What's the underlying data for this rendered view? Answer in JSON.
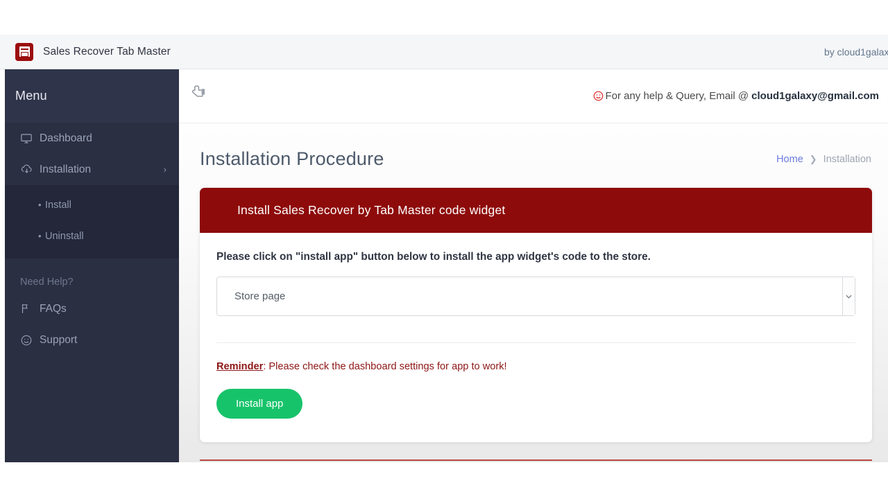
{
  "appbar": {
    "title": "Sales Recover Tab Master",
    "icon": "app-window-icon",
    "author": "by cloud1galax"
  },
  "sidebar": {
    "menu_label": "Menu",
    "items": [
      {
        "label": "Dashboard",
        "icon": "monitor-icon"
      },
      {
        "label": "Installation",
        "icon": "cloud-download-icon",
        "chevron": "›"
      }
    ],
    "sub_items": [
      {
        "label": "Install",
        "bullet": "•"
      },
      {
        "label": "Uninstall",
        "bullet": "•"
      }
    ],
    "help_label": "Need Help?",
    "help_items": [
      {
        "label": "FAQs",
        "icon": "flag-icon"
      },
      {
        "label": "Support",
        "icon": "smiley-icon"
      }
    ]
  },
  "topbar": {
    "cursor_icon": "hand-pointer-cursor",
    "smiley_icon": "smiley-face-icon",
    "help_prefix": "For any help & Query, Email @ ",
    "email": "cloud1galaxy@gmail.com"
  },
  "page": {
    "title": "Installation Procedure",
    "breadcrumb": {
      "home": "Home",
      "separator": "❯",
      "current": "Installation"
    }
  },
  "card": {
    "header": "Install Sales Recover by Tab Master code widget",
    "instruction": "Please click on \"install app\" button below to install the app widget's code to the store.",
    "select": {
      "value": "Store page",
      "arrow_icon": "chevron-down-icon"
    },
    "reminder_label": "Reminder",
    "reminder_text": ": Please check the dashboard settings for app to work!",
    "install_button": "Install app"
  },
  "colors": {
    "sidebar_bg": "#2b2f42",
    "card_header_red": "#8e0b0b",
    "install_green": "#17c36a",
    "breadcrumb_link": "#6c7ae0",
    "reminder_red": "#8e1616"
  }
}
